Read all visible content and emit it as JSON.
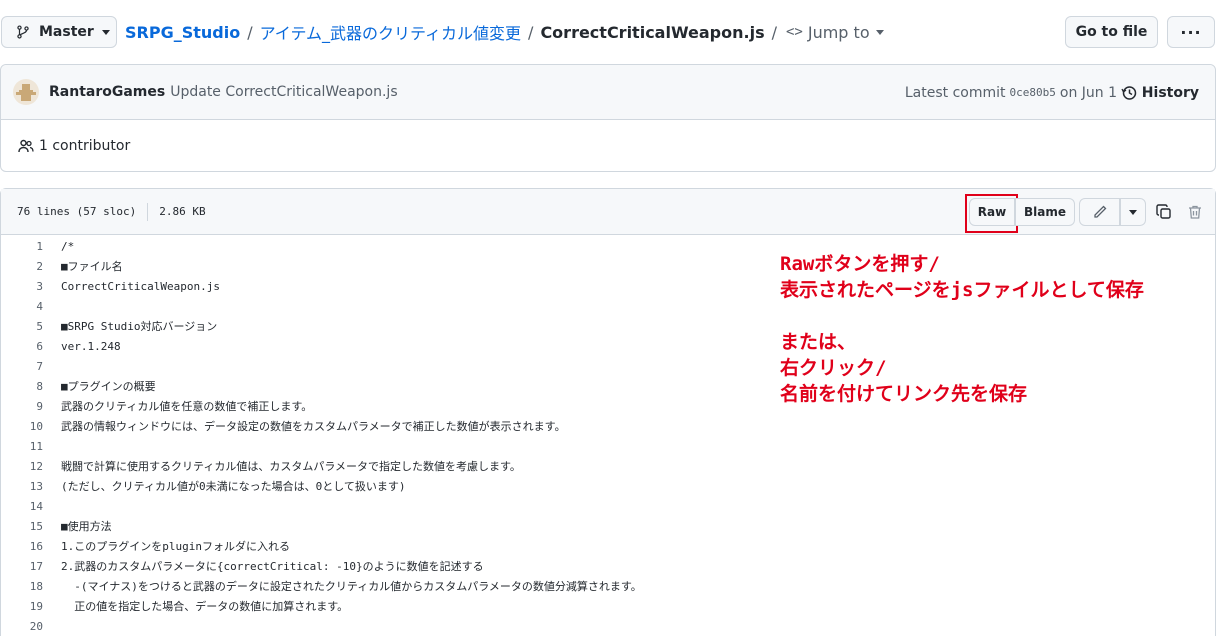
{
  "topbar": {
    "branch_label": "Master",
    "repo": "SRPG_Studio",
    "folder": "アイテム_武器のクリティカル値変更",
    "separator": "/",
    "file": "CorrectCriticalWeapon.js",
    "jump_to": "Jump to",
    "go_to_file": "Go to file",
    "more": "···"
  },
  "commit": {
    "author": "RantaroGames",
    "message": "Update CorrectCriticalWeapon.js",
    "latest_label": "Latest commit",
    "sha": "0ce80b5",
    "date": "on Jun 1",
    "history_label": "History",
    "contributors": "1 contributor"
  },
  "file": {
    "lines_info": "76 lines (57 sloc)",
    "size": "2.86 KB",
    "raw_label": "Raw",
    "blame_label": "Blame"
  },
  "code_lines": [
    {
      "n": "1",
      "text": "/*"
    },
    {
      "n": "2",
      "text": "■ファイル名"
    },
    {
      "n": "3",
      "text": "CorrectCriticalWeapon.js"
    },
    {
      "n": "4",
      "text": ""
    },
    {
      "n": "5",
      "text": "■SRPG Studio対応バージョン"
    },
    {
      "n": "6",
      "text": "ver.1.248"
    },
    {
      "n": "7",
      "text": ""
    },
    {
      "n": "8",
      "text": "■プラグインの概要"
    },
    {
      "n": "9",
      "text": "武器のクリティカル値を任意の数値で補正します。"
    },
    {
      "n": "10",
      "text": "武器の情報ウィンドウには、データ設定の数値をカスタムパラメータで補正した数値が表示されます。"
    },
    {
      "n": "11",
      "text": ""
    },
    {
      "n": "12",
      "text": "戦闘で計算に使用するクリティカル値は、カスタムパラメータで指定した数値を考慮します。"
    },
    {
      "n": "13",
      "text": "(ただし、クリティカル値が0未満になった場合は、0として扱います)"
    },
    {
      "n": "14",
      "text": ""
    },
    {
      "n": "15",
      "text": "■使用方法"
    },
    {
      "n": "16",
      "text": "1.このプラグインをpluginフォルダに入れる"
    },
    {
      "n": "17",
      "text": "2.武器のカスタムパラメータに{correctCritical: -10}のように数値を記述する"
    },
    {
      "n": "18",
      "text": "  -(マイナス)をつけると武器のデータに設定されたクリティカル値からカスタムパラメータの数値分減算されます。"
    },
    {
      "n": "19",
      "text": "  正の値を指定した場合、データの数値に加算されます。"
    },
    {
      "n": "20",
      "text": ""
    }
  ],
  "annotation": {
    "text": "Rawボタンを押す/\n表示されたページをjsファイルとして保存\n\nまたは、\n右クリック/\n名前を付けてリンク先を保存",
    "color": "#e0001a"
  },
  "icons": {
    "branch": "git-branch-icon",
    "history": "history-icon",
    "people": "people-icon",
    "edit": "pencil-icon",
    "copy": "copy-icon",
    "trash": "trash-icon"
  }
}
